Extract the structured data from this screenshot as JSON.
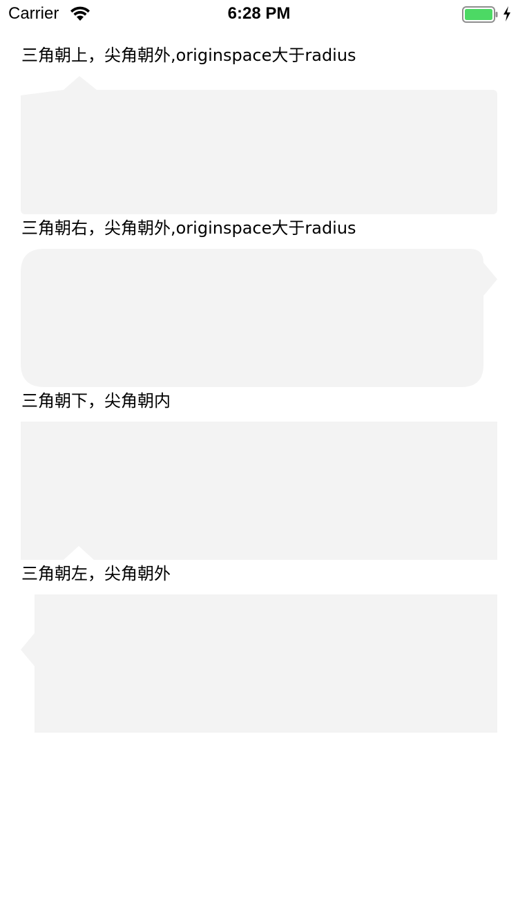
{
  "status_bar": {
    "carrier": "Carrier",
    "time": "6:28 PM",
    "icons": [
      "wifi-icon",
      "battery-icon",
      "charging-icon"
    ],
    "battery_color": "#4cd964"
  },
  "bubble_color": "#f3f3f3",
  "sections": [
    {
      "label": "三角朝上，尖角朝外,originspace大于radius"
    },
    {
      "label": "三角朝右，尖角朝外,originspace大于radius"
    },
    {
      "label": "三角朝下，尖角朝内"
    },
    {
      "label": "三角朝左，尖角朝外"
    }
  ]
}
